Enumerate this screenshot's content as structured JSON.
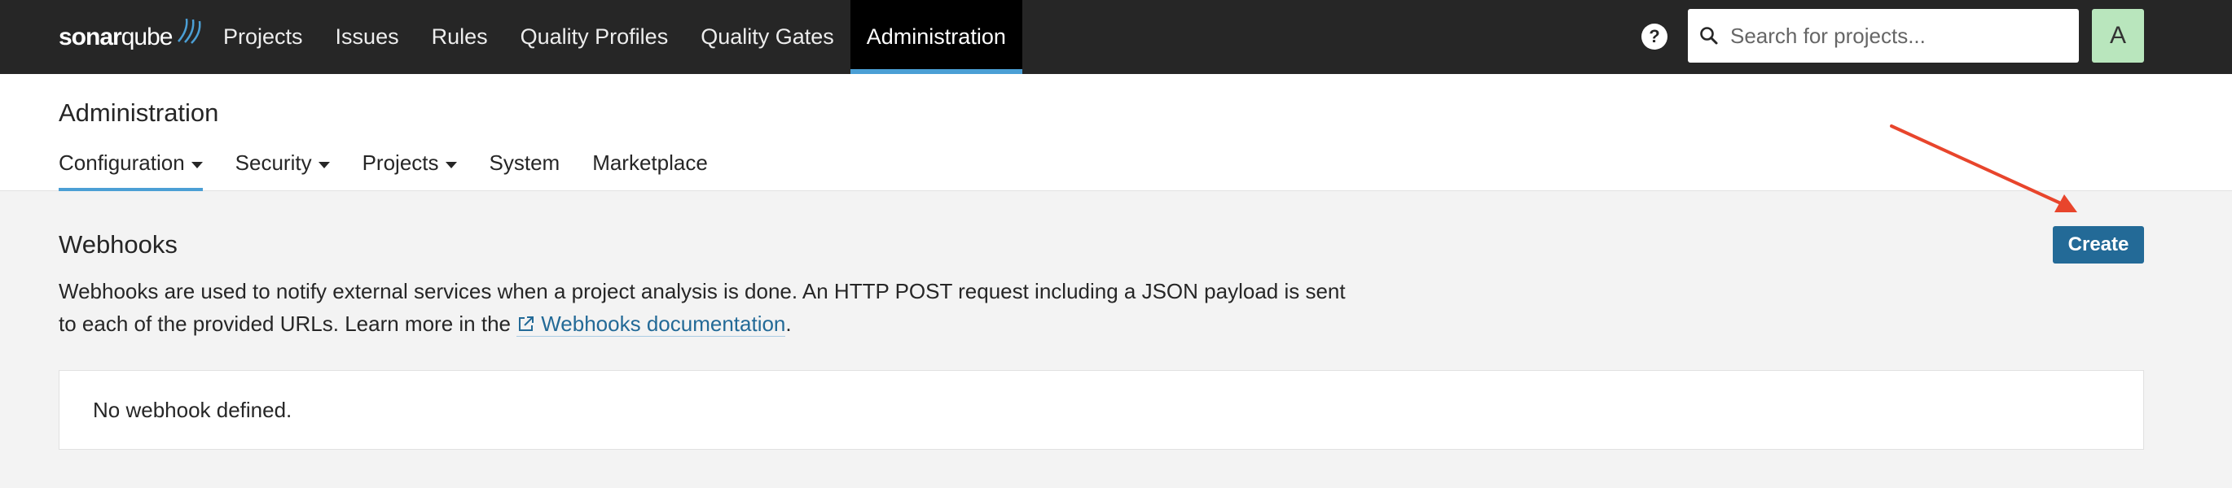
{
  "app": {
    "logo_bold": "sonar",
    "logo_light": "qube"
  },
  "topnav": {
    "items": [
      {
        "label": "Projects",
        "active": false
      },
      {
        "label": "Issues",
        "active": false
      },
      {
        "label": "Rules",
        "active": false
      },
      {
        "label": "Quality Profiles",
        "active": false
      },
      {
        "label": "Quality Gates",
        "active": false
      },
      {
        "label": "Administration",
        "active": true
      }
    ],
    "help_symbol": "?",
    "search_placeholder": "Search for projects...",
    "avatar_letter": "A"
  },
  "admin": {
    "title": "Administration",
    "tabs": [
      {
        "label": "Configuration",
        "dropdown": true,
        "active": true
      },
      {
        "label": "Security",
        "dropdown": true,
        "active": false
      },
      {
        "label": "Projects",
        "dropdown": true,
        "active": false
      },
      {
        "label": "System",
        "dropdown": false,
        "active": false
      },
      {
        "label": "Marketplace",
        "dropdown": false,
        "active": false
      }
    ]
  },
  "webhooks": {
    "title": "Webhooks",
    "description_line1": "Webhooks are used to notify external services when a project analysis is done. An HTTP POST request including a JSON payload is sent",
    "description_line2_prefix": "to each of the provided URLs. Learn more in the",
    "doc_link": "Webhooks documentation",
    "description_suffix": ".",
    "create_label": "Create",
    "empty_message": "No webhook defined."
  },
  "colors": {
    "topbar": "#262626",
    "accent": "#4b9fd5",
    "button": "#236a97",
    "avatar": "#b9e6bd",
    "annotation_arrow": "#e8452c"
  }
}
